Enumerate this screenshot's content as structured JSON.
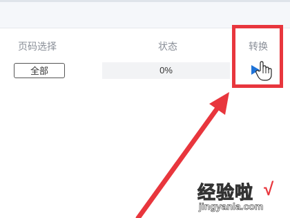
{
  "table": {
    "headers": {
      "page_select": "页码选择",
      "status": "状态",
      "convert": "转换"
    },
    "row": {
      "page_button_label": "全部",
      "progress_text": "0%",
      "progress_value": 0
    }
  },
  "annotation": {
    "highlight_color": "#e8363d"
  },
  "watermark": {
    "line1": "经验啦",
    "check": "√",
    "line2": "jingyanla.com"
  }
}
